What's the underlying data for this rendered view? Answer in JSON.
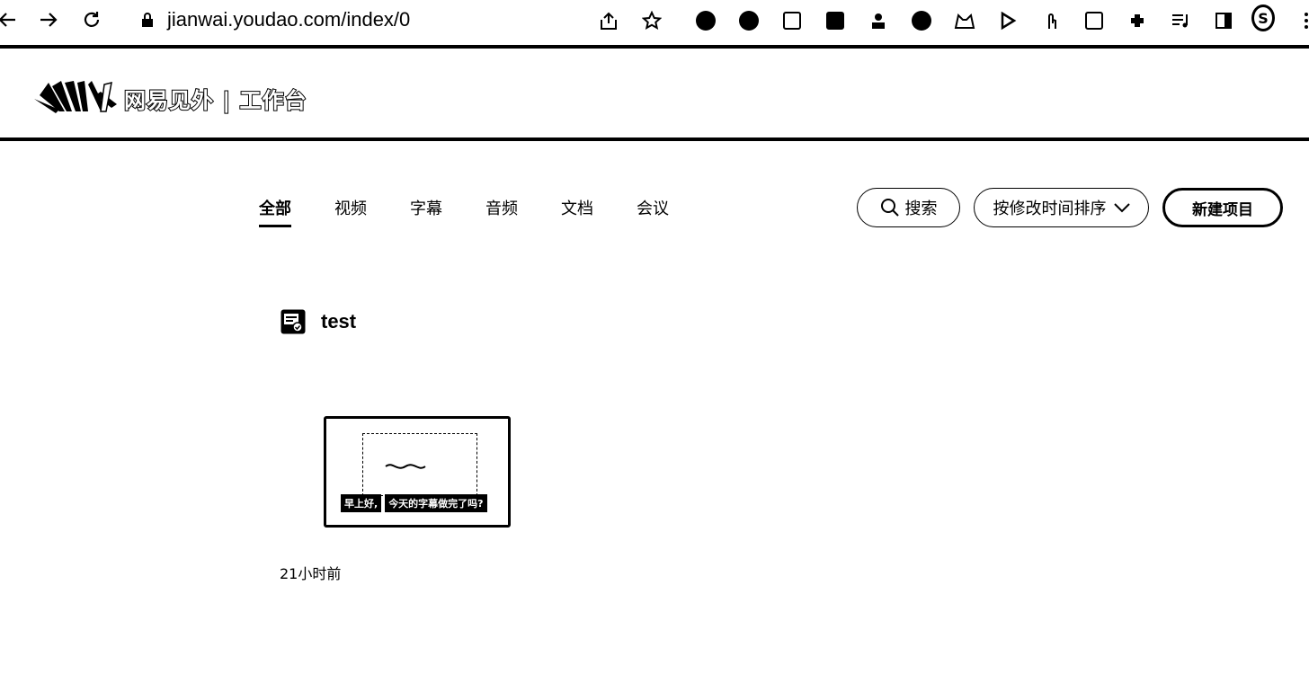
{
  "browser": {
    "url": "jianwai.youdao.com/index/0",
    "profile_initial": "S"
  },
  "header": {
    "logo_text": "网易见外 | 工作台"
  },
  "tabs": [
    {
      "label": "全部",
      "active": true
    },
    {
      "label": "视频",
      "active": false
    },
    {
      "label": "字幕",
      "active": false
    },
    {
      "label": "音频",
      "active": false
    },
    {
      "label": "文档",
      "active": false
    },
    {
      "label": "会议",
      "active": false
    }
  ],
  "toolbar": {
    "search_label": "搜索",
    "sort_label": "按修改时间排序",
    "new_label": "新建项目"
  },
  "project": {
    "title": "test",
    "thumbnail_caption_1": "早上好,",
    "thumbnail_caption_2": "今天的字幕做完了吗?",
    "time": "21小时前"
  }
}
